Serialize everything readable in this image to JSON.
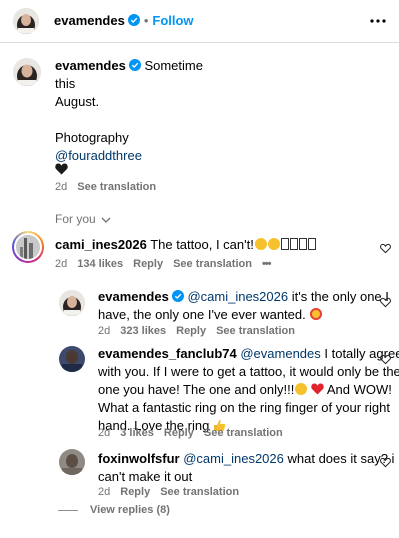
{
  "header": {
    "username": "evamendes",
    "separator": "•",
    "follow_label": "Follow"
  },
  "caption": {
    "username": "evamendes",
    "lines": [
      "Sometime",
      "this",
      "August.",
      "",
      "Photography"
    ],
    "mention": "@fouraddthree",
    "age": "2d",
    "see_translation": "See translation"
  },
  "for_you_label": "For you",
  "comments": [
    {
      "username": "cami_ines2026",
      "text": "The tattoo, I can't!",
      "age": "2d",
      "likes": "134 likes",
      "reply": "Reply",
      "see_translation": "See translation",
      "more": "•••"
    },
    {
      "username": "evamendes",
      "mention": "@cami_ines2026",
      "text_line1": " it's the only one I",
      "text_line2": "have, the only one I've ever wanted.",
      "age": "2d",
      "likes": "323 likes",
      "reply": "Reply",
      "see_translation": "See translation"
    },
    {
      "username": "evamendes_fanclub74",
      "mention": "@evamendes",
      "text_line1": " I totally agree",
      "text_line2": "with you. If I were to get a tattoo, it would only be the",
      "text_line3": "one you have! The one and only!!!",
      "text_line3b": " And WOW!",
      "text_line4": "What a fantastic ring on the ring finger of your right",
      "text_line5": "hand. Love the ring",
      "age": "2d",
      "likes": "3 likes",
      "reply": "Reply",
      "see_translation": "See translation"
    },
    {
      "username": "foxinwolfsfur",
      "mention": "@cami_ines2026",
      "text_line1": " what does it say? i",
      "text_line2": "can't make it out",
      "age": "2d",
      "reply": "Reply",
      "see_translation": "See translation"
    }
  ],
  "view_replies": "View replies (8)",
  "colors": {
    "accent": "#0095f6",
    "verified": "#0095f6",
    "muted": "#737373",
    "mention": "#00376b"
  }
}
